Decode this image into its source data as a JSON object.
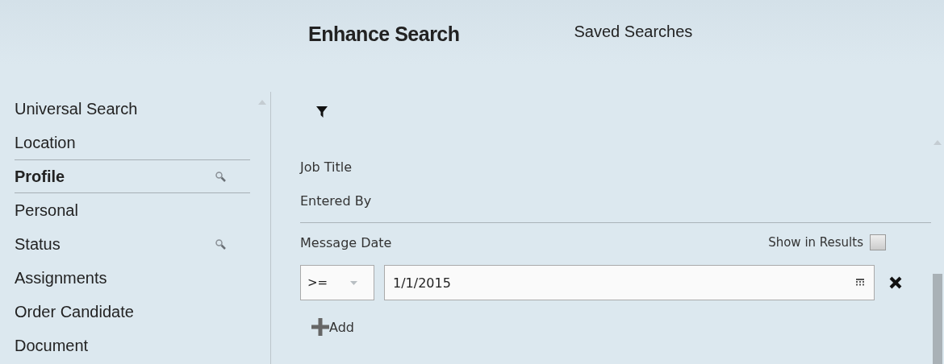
{
  "tabs": [
    {
      "label": "Enhance Search",
      "selected": true
    },
    {
      "label": "Saved Searches",
      "selected": false
    }
  ],
  "sidebar": {
    "items": [
      {
        "label": "Universal Search",
        "selected": false,
        "search_icon": false
      },
      {
        "label": "Location",
        "selected": false,
        "search_icon": false
      },
      {
        "label": "Profile",
        "selected": true,
        "search_icon": true
      },
      {
        "label": "Personal",
        "selected": false,
        "search_icon": false
      },
      {
        "label": "Status",
        "selected": false,
        "search_icon": true
      },
      {
        "label": "Assignments",
        "selected": false,
        "search_icon": false
      },
      {
        "label": "Order Candidate",
        "selected": false,
        "search_icon": false
      },
      {
        "label": "Document",
        "selected": false,
        "search_icon": false
      }
    ]
  },
  "fields": [
    {
      "label": "Job Title"
    },
    {
      "label": "Entered By"
    }
  ],
  "criterion": {
    "label": "Message Date",
    "show_in_results_label": "Show in Results",
    "show_in_results_checked": false,
    "operator": ">=",
    "value": "1/1/2015"
  },
  "add_button": "Add"
}
